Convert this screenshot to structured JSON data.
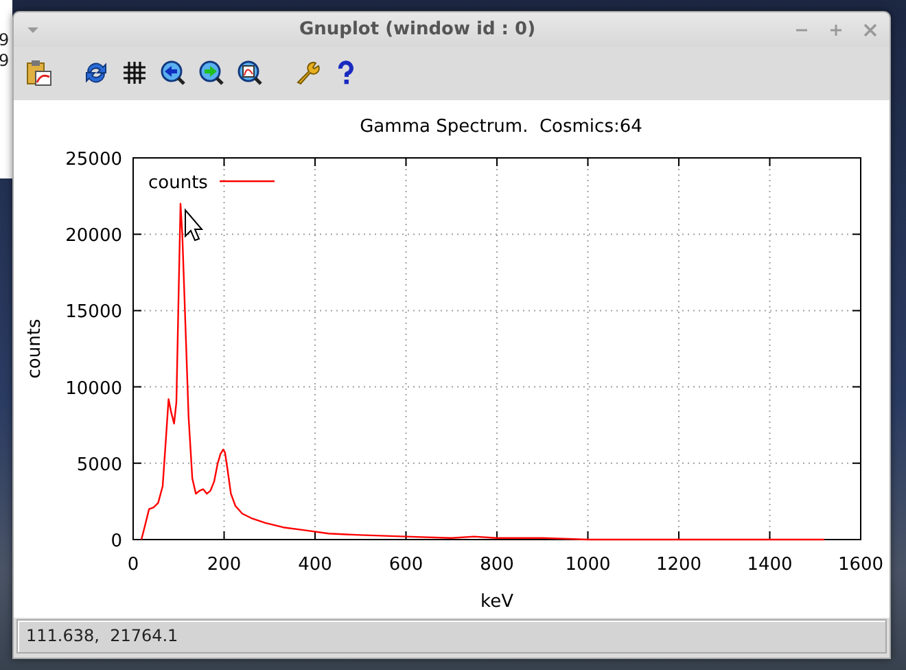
{
  "background_window": {
    "lines": [
      "9",
      "9"
    ]
  },
  "window": {
    "title": "Gnuplot (window id : 0)"
  },
  "plot": {
    "chart_data": {
      "type": "line",
      "title": "Gamma Spectrum.  Cosmics:64",
      "xlabel": "keV",
      "ylabel": "counts",
      "grid": true,
      "x": [
        18,
        25,
        35,
        45,
        55,
        65,
        72,
        78,
        84,
        90,
        95,
        100,
        104,
        108,
        115,
        122,
        130,
        138,
        146,
        154,
        162,
        170,
        178,
        186,
        192,
        198,
        202,
        208,
        215,
        225,
        240,
        260,
        290,
        330,
        380,
        430,
        500,
        600,
        700,
        750,
        800,
        900,
        1000,
        1100,
        1200,
        1300,
        1400,
        1500,
        1520
      ],
      "series": [
        {
          "name": "counts",
          "color": "#ff0000",
          "values": [
            0,
            800,
            2000,
            2100,
            2400,
            3500,
            6500,
            9200,
            8300,
            7600,
            9000,
            16000,
            22000,
            20000,
            14000,
            8000,
            4000,
            3000,
            3200,
            3300,
            3000,
            3200,
            3800,
            5000,
            5600,
            5900,
            5700,
            4500,
            3000,
            2200,
            1700,
            1400,
            1100,
            800,
            600,
            400,
            300,
            200,
            100,
            200,
            100,
            100,
            0,
            0,
            0,
            0,
            0,
            0,
            0
          ]
        }
      ],
      "xlim": [
        0,
        1600
      ],
      "ylim": [
        0,
        25000
      ],
      "xticks": [
        0,
        200,
        400,
        600,
        800,
        1000,
        1200,
        1400,
        1600
      ],
      "yticks": [
        0,
        5000,
        10000,
        15000,
        20000,
        25000
      ]
    }
  },
  "status_bar": {
    "text": "111.638,  21764.1"
  }
}
